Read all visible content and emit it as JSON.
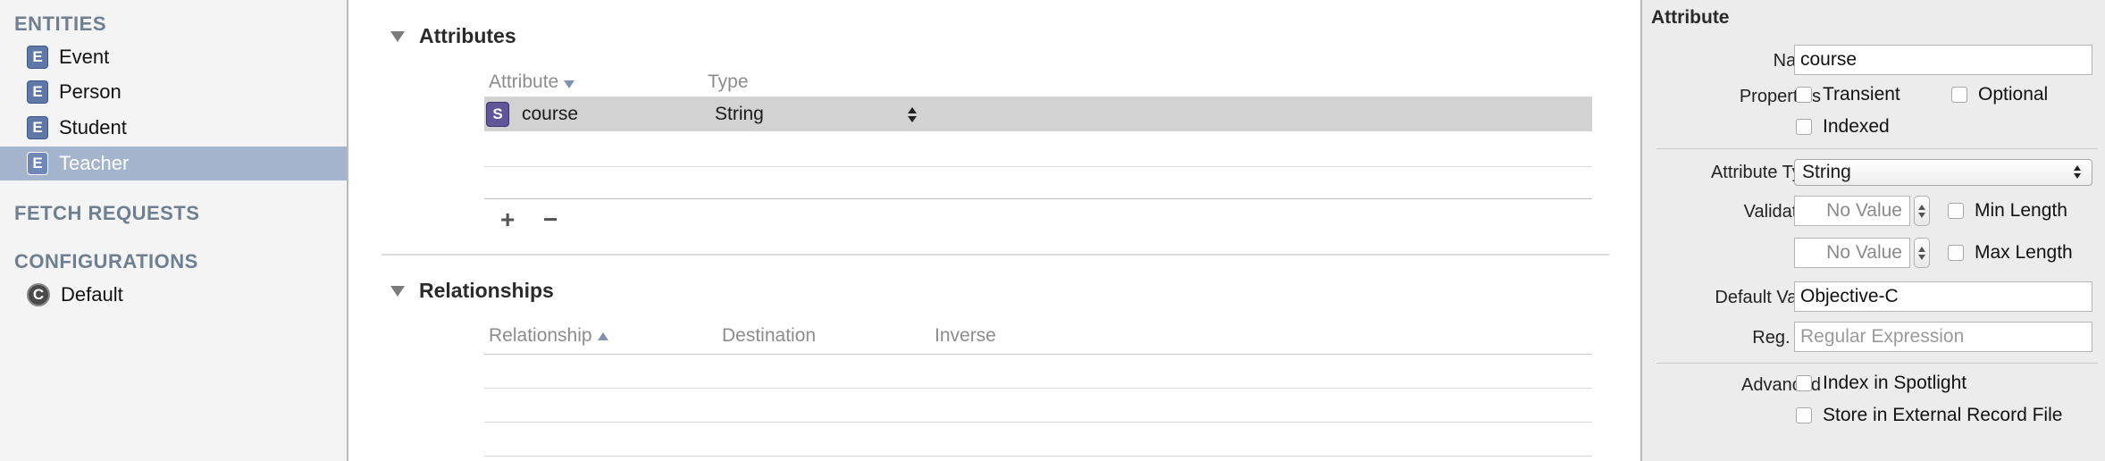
{
  "sidebar": {
    "entities_header": "ENTITIES",
    "entities": [
      {
        "icon": "E",
        "label": "Event"
      },
      {
        "icon": "E",
        "label": "Person"
      },
      {
        "icon": "E",
        "label": "Student"
      },
      {
        "icon": "E",
        "label": "Teacher",
        "selected": true
      }
    ],
    "fetch_requests_header": "FETCH REQUESTS",
    "configurations_header": "CONFIGURATIONS",
    "configurations": [
      {
        "icon": "C",
        "label": "Default"
      }
    ]
  },
  "main": {
    "attributes": {
      "title": "Attributes",
      "col_attribute": "Attribute",
      "col_type": "Type",
      "rows": [
        {
          "icon": "S",
          "name": "course",
          "type": "String"
        }
      ],
      "add_label": "+",
      "remove_label": "−"
    },
    "relationships": {
      "title": "Relationships",
      "col_relationship": "Relationship",
      "col_destination": "Destination",
      "col_inverse": "Inverse"
    }
  },
  "inspector": {
    "title": "Attribute",
    "name_label": "Name",
    "name_value": "course",
    "properties_label": "Properties",
    "transient_label": "Transient",
    "optional_label": "Optional",
    "indexed_label": "Indexed",
    "attribute_type_label": "Attribute Type",
    "attribute_type_value": "String",
    "validation_label": "Validation",
    "min_value": "No Value",
    "min_length_label": "Min Length",
    "max_value": "No Value",
    "max_length_label": "Max Length",
    "default_value_label": "Default Value",
    "default_value": "Objective-C",
    "regex_label": "Reg. Ex.",
    "regex_placeholder": "Regular Expression",
    "advanced_label": "Advanced",
    "index_spotlight_label": "Index in Spotlight",
    "external_record_label": "Store in External Record File"
  }
}
